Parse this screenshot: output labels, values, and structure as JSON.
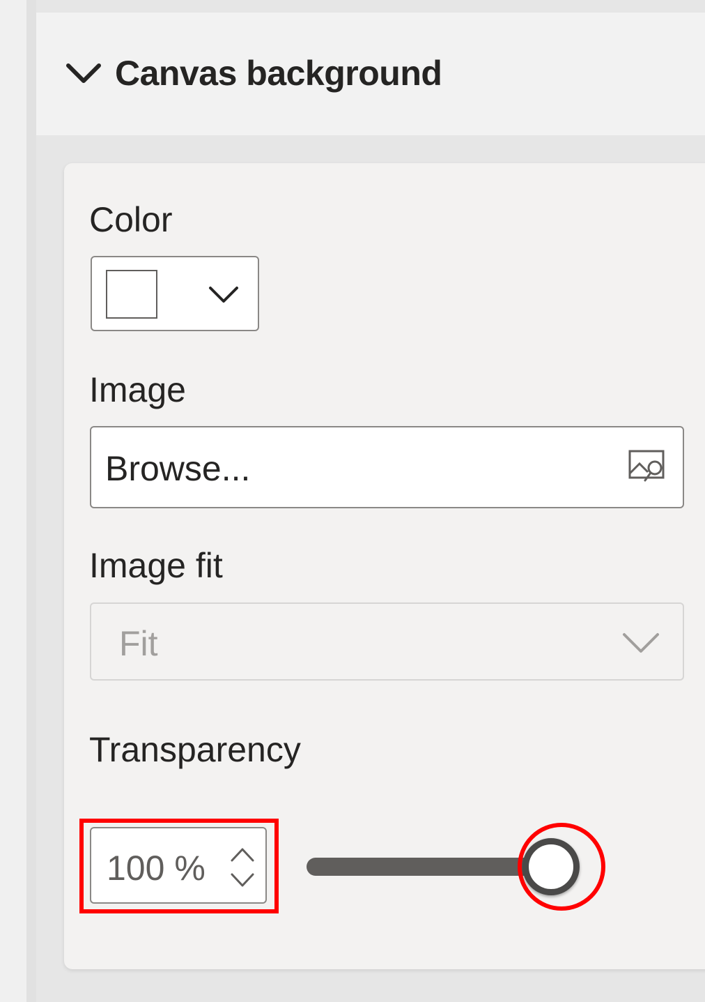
{
  "section": {
    "title": "Canvas background",
    "expanded": true
  },
  "color": {
    "label": "Color",
    "value": "#ffffff"
  },
  "image": {
    "label": "Image",
    "browse_text": "Browse...",
    "icon": "browse-image-icon"
  },
  "image_fit": {
    "label": "Image fit",
    "value": "Fit",
    "disabled": true
  },
  "transparency": {
    "label": "Transparency",
    "value_text": "100 %",
    "value": 100,
    "slider_fraction": 1.0
  },
  "colors": {
    "highlight": "#ff0000",
    "text": "#252423",
    "disabled_text": "#a19f9d",
    "slider_track": "#605e5c"
  }
}
